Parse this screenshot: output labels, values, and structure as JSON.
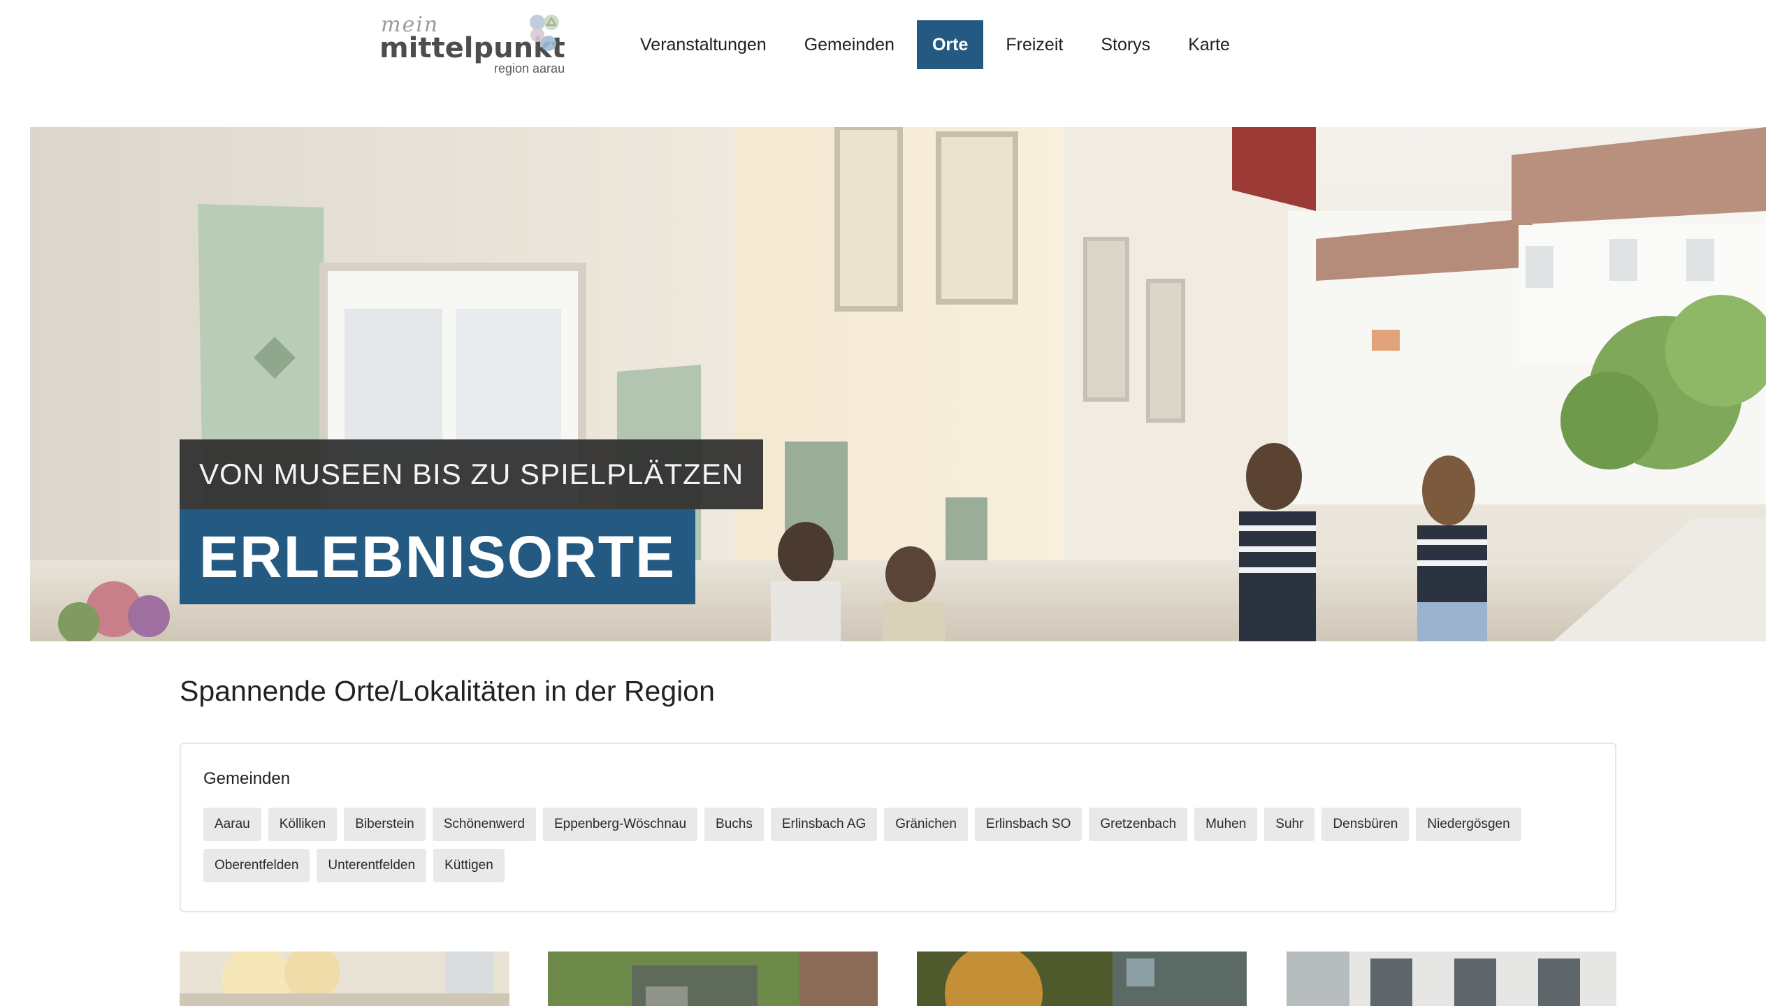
{
  "brand": {
    "mein": "mein",
    "name": "mittelpunkt",
    "sub": "region aarau",
    "dot_colors": [
      "#b8c7d8",
      "#cbd7c1",
      "#d8c9d6",
      "#9fb9d6"
    ]
  },
  "nav": {
    "items": [
      {
        "label": "Veranstaltungen"
      },
      {
        "label": "Gemeinden"
      },
      {
        "label": "Orte",
        "active": true
      },
      {
        "label": "Freizeit"
      },
      {
        "label": "Storys"
      },
      {
        "label": "Karte"
      }
    ]
  },
  "hero": {
    "subtitle": "VON MUSEEN BIS ZU SPIELPLÄTZEN",
    "title": "ERLEBNISORTE"
  },
  "section": {
    "title": "Spannende Orte/Lokalitäten in der Region"
  },
  "filter": {
    "label": "Gemeinden",
    "chips": [
      "Aarau",
      "Kölliken",
      "Biberstein",
      "Schönenwerd",
      "Eppenberg-Wöschnau",
      "Buchs",
      "Erlinsbach AG",
      "Gränichen",
      "Erlinsbach SO",
      "Gretzenbach",
      "Muhen",
      "Suhr",
      "Densbüren",
      "Niedergösgen",
      "Oberentfelden",
      "Unterentfelden",
      "Küttigen"
    ]
  },
  "colors": {
    "accent": "#245a82",
    "chip_bg": "#e9e9e9",
    "dark_label": "#2c2c2c"
  }
}
